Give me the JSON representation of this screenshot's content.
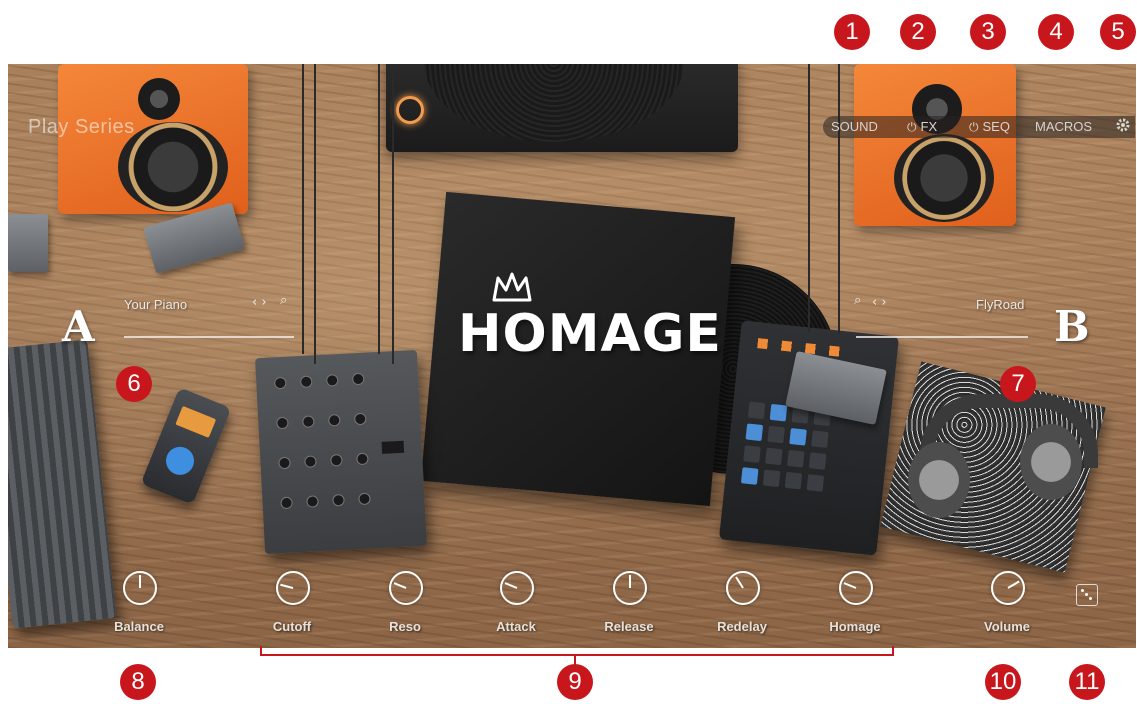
{
  "app": {
    "brand": "Play Series",
    "logo": "HOMAGE"
  },
  "topnav": {
    "sound": "SOUND",
    "fx": "FX",
    "seq": "SEQ",
    "macros": "MACROS",
    "power_icon": "⏻",
    "settings_icon": "gear-icon"
  },
  "layer_a": {
    "letter": "A",
    "preset": "Your Piano",
    "nav_icon": "‹ ›",
    "search_icon": "⌕"
  },
  "layer_b": {
    "letter": "B",
    "preset": "FlyRoad",
    "nav_icon": "‹ ›",
    "search_icon": "⌕"
  },
  "knobs": [
    {
      "label": "Balance",
      "value": 0.5
    },
    {
      "label": "Cutoff",
      "value": 0.22
    },
    {
      "label": "Reso",
      "value": 0.25
    },
    {
      "label": "Attack",
      "value": 0.25
    },
    {
      "label": "Release",
      "value": 0.5
    },
    {
      "label": "Redelay",
      "value": 0.38
    },
    {
      "label": "Homage",
      "value": 0.25
    },
    {
      "label": "Volume",
      "value": 0.72
    }
  ],
  "callouts": [
    "1",
    "2",
    "3",
    "4",
    "5",
    "6",
    "7",
    "8",
    "9",
    "10",
    "11"
  ],
  "colors": {
    "callout": "#c8161d",
    "accent_orange": "#f4873a",
    "pad_blue": "#4d8fd6"
  }
}
